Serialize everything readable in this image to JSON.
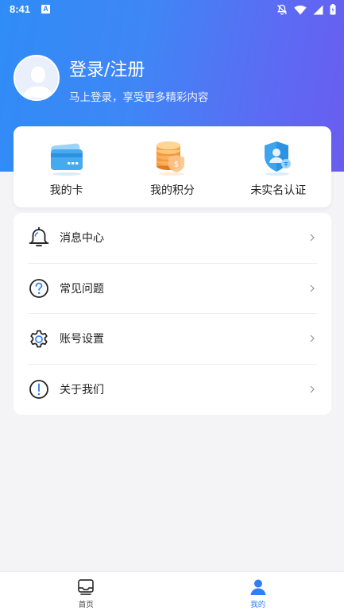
{
  "status_bar": {
    "time": "8:41",
    "indicator": "A"
  },
  "profile": {
    "title": "登录/注册",
    "subtitle": "马上登录，享受更多精彩内容"
  },
  "quick_actions": [
    {
      "label": "我的卡",
      "icon": "card-icon"
    },
    {
      "label": "我的积分",
      "icon": "coins-icon"
    },
    {
      "label": "未实名认证",
      "icon": "verify-shield-icon"
    }
  ],
  "menu": [
    {
      "label": "消息中心",
      "icon": "bell-icon"
    },
    {
      "label": "常见问题",
      "icon": "question-icon"
    },
    {
      "label": "账号设置",
      "icon": "gear-icon"
    },
    {
      "label": "关于我们",
      "icon": "info-icon"
    }
  ],
  "bottom_nav": [
    {
      "label": "首页",
      "icon": "home-tray-icon",
      "active": false
    },
    {
      "label": "我的",
      "icon": "user-icon",
      "active": true
    }
  ],
  "colors": {
    "accent": "#2f7ff6",
    "gradient_start": "#2f8cf6",
    "gradient_end": "#6a5cf0"
  }
}
